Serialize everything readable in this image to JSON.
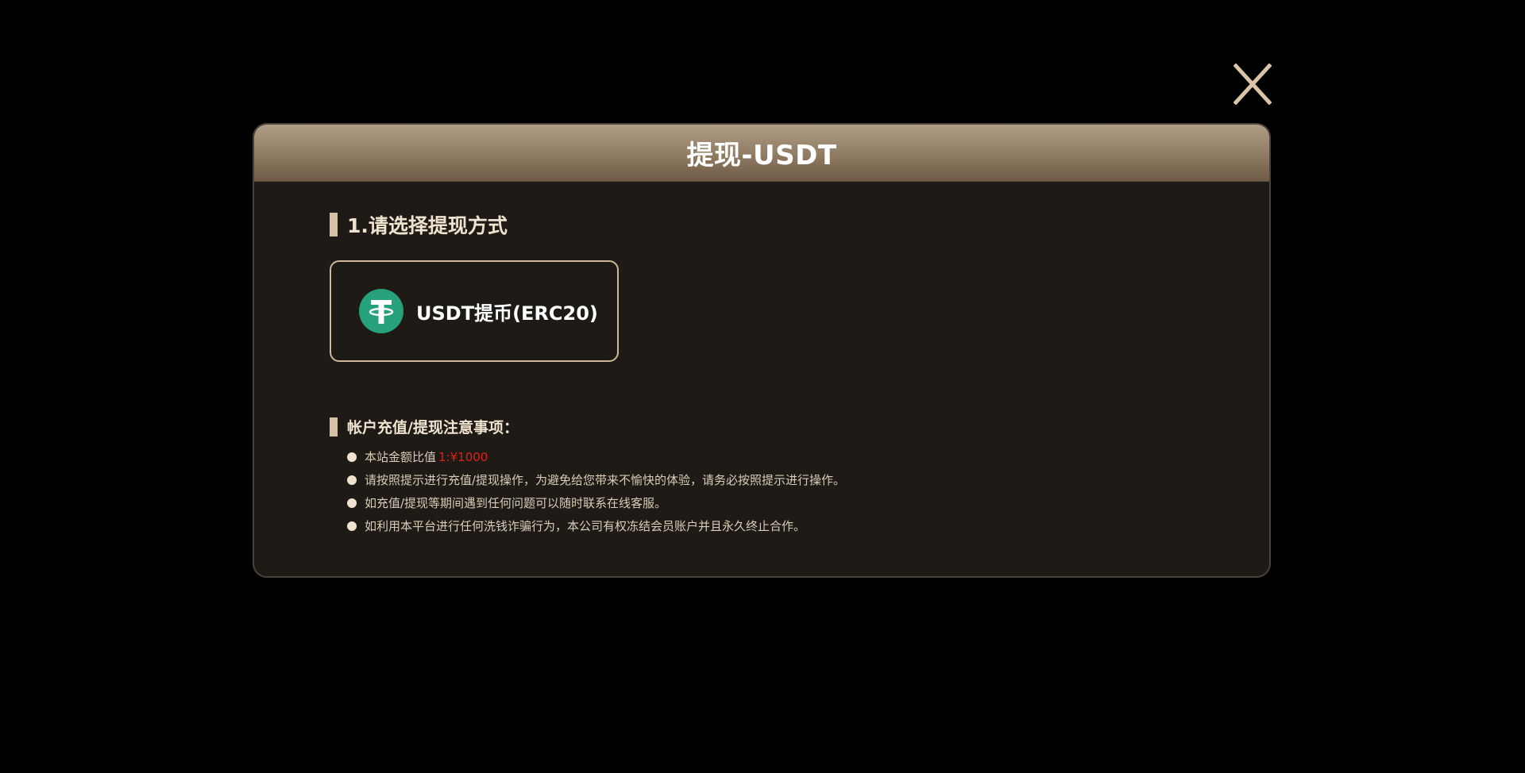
{
  "modal": {
    "title": "提现-USDT"
  },
  "close_icon": "close-icon",
  "section1": {
    "heading": "1.请选择提现方式"
  },
  "method": {
    "icon": "usdt-tether-icon",
    "label": "USDT提币(ERC20)",
    "icon_color": "#26a17b"
  },
  "section2": {
    "heading": "帐户充值/提现注意事项："
  },
  "notes": [
    {
      "text": "本站金额比值",
      "highlight": "1:¥1000"
    },
    {
      "text": "请按照提示进行充值/提现操作，为避免给您带来不愉快的体验，请务必按照提示进行操作。"
    },
    {
      "text": "如充值/提现等期间遇到任何问题可以随时联系在线客服。"
    },
    {
      "text": "如利用本平台进行任何洗钱诈骗行为，本公司有权冻结会员账户并且永久终止合作。"
    }
  ],
  "colors": {
    "accent": "#d6c2a7",
    "highlight": "#e0201c",
    "background": "#1e1a16"
  }
}
